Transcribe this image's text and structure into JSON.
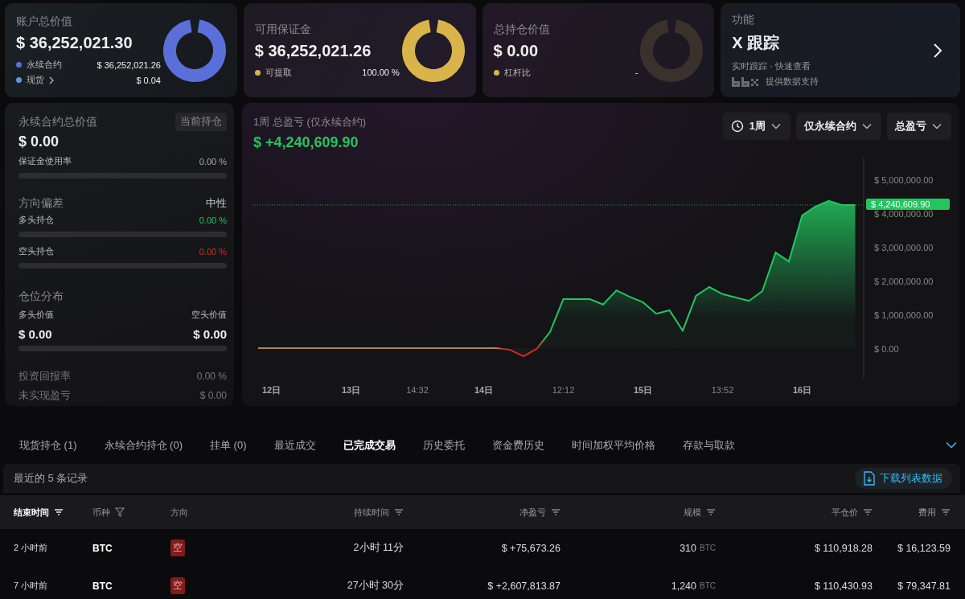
{
  "summary_cards": [
    {
      "title": "账户总价值",
      "value": "$ 36,252,021.30",
      "color": "#5b6fd8",
      "legend": [
        {
          "label": "永续合约",
          "value": "$ 36,252,021.26",
          "color": "#5b6fd8",
          "link": false
        },
        {
          "label": "现货",
          "value": "$ 0.04",
          "color": "#5b9bd8",
          "link": true
        }
      ]
    },
    {
      "title": "可用保证金",
      "value": "$ 36,252,021.26",
      "color": "#d9b44a",
      "legend": [
        {
          "label": "可提取",
          "value": "100.00 %",
          "color": "#d9b44a",
          "link": false
        }
      ]
    },
    {
      "title": "总持仓价值",
      "value": "$ 0.00",
      "color": "#3a302c",
      "legend": [
        {
          "label": "杠杆比",
          "value": "-",
          "color": "#d9b44a",
          "link": false
        }
      ]
    }
  ],
  "feature_card": {
    "title": "功能",
    "name": "X 跟踪",
    "subtitle": "实时跟踪 · 快速查看",
    "credit": "提供数据支持"
  },
  "perp_panel": {
    "title": "永续合约总价值",
    "badge": "当前持仓",
    "value": "$ 0.00",
    "margin": {
      "label": "保证金使用率",
      "reading": "0.00 %",
      "level": 0
    },
    "bias": {
      "title": "方向偏差",
      "value": "中性"
    },
    "long": {
      "label": "多头持仓",
      "reading": "0.00 %",
      "level": 0
    },
    "short": {
      "label": "空头持仓",
      "reading": "0.00 %",
      "level": 0
    },
    "distribution": {
      "title": "仓位分布",
      "long_label": "多头价值",
      "short_label": "空头价值",
      "long_value": "$ 0.00",
      "short_value": "$ 0.00",
      "level": 0
    },
    "roi": {
      "label": "投资回报率",
      "value": "0.00 %"
    },
    "unrealized": {
      "label": "未实现盈亏",
      "value": "$ 0.00"
    }
  },
  "pnl_panel": {
    "title": "1周 总盈亏 (仅永续合约)",
    "value": "$ +4,240,609.90",
    "filters": [
      "1周",
      "仅永续合约",
      "总盈亏"
    ],
    "chart_data": {
      "type": "area",
      "ylim": [
        -900000,
        5650000
      ],
      "categories": [
        null,
        "12日",
        null,
        null,
        null,
        null,
        null,
        "13日",
        null,
        null,
        null,
        null,
        "14:32",
        null,
        null,
        null,
        null,
        "14日",
        null,
        null,
        null,
        null,
        null,
        "12:12",
        null,
        null,
        null,
        null,
        null,
        "15日",
        null,
        null,
        null,
        null,
        null,
        "13:52",
        null,
        null,
        null,
        null,
        null,
        "16日",
        null,
        null,
        null,
        null
      ],
      "yticks": [
        {
          "value": 0,
          "label": "$ 0.00"
        },
        {
          "value": 1000000,
          "label": "$ 1,000,000.00"
        },
        {
          "value": 2000000,
          "label": "$ 2,000,000.00"
        },
        {
          "value": 3000000,
          "label": "$ 3,000,000.00"
        },
        {
          "value": 4000000,
          "label": "$ 4,000,000.00"
        },
        {
          "value": 5000000,
          "label": "$ 5,000,000.00"
        }
      ],
      "series": [
        {
          "color": "#22c55e",
          "values": [
            0,
            0,
            0,
            0,
            0,
            0,
            0,
            0,
            0,
            0,
            0,
            0,
            0,
            0,
            0,
            0,
            0,
            0,
            0,
            -50000,
            -240000,
            -20000,
            480000,
            1450000,
            1450000,
            1450000,
            1290000,
            1710000,
            1520000,
            1360000,
            1020000,
            1120000,
            520000,
            1550000,
            1810000,
            1600000,
            1500000,
            1400000,
            1690000,
            2830000,
            2570000,
            3930000,
            4190000,
            4360000,
            4240000,
            4240000
          ]
        }
      ],
      "ref_lines": [
        {
          "axis": "y",
          "value": 4240609.9,
          "label": "$ 4,240,609.90"
        }
      ]
    }
  },
  "tabs": [
    {
      "label": "现货持仓 (1)",
      "selected": false
    },
    {
      "label": "永续合约持仓 (0)",
      "selected": false
    },
    {
      "label": "挂单 (0)",
      "selected": false
    },
    {
      "label": "最近成交",
      "selected": false
    },
    {
      "label": "已完成交易",
      "selected": true
    },
    {
      "label": "历史委托",
      "selected": false
    },
    {
      "label": "资金费历史",
      "selected": false
    },
    {
      "label": "时间加权平均价格",
      "selected": false
    },
    {
      "label": "存款与取款",
      "selected": false
    }
  ],
  "table": {
    "caption": "最近的 5 条记录",
    "download": "下载列表数据",
    "columns": [
      {
        "label": "结束时间",
        "sorted": true
      },
      {
        "label": "币种",
        "sorted": false
      },
      {
        "label": "方向",
        "sorted": false
      },
      {
        "label": "持续时间",
        "sorted": false
      },
      {
        "label": "净盈亏",
        "sorted": false
      },
      {
        "label": "规模",
        "sorted": false
      },
      {
        "label": "平仓价",
        "sorted": false
      },
      {
        "label": "费用",
        "sorted": false
      }
    ],
    "rows": [
      {
        "time": "2 小时前",
        "coin": "BTC",
        "side": "空",
        "duration": "2小时 11分",
        "pnl": "$ +75,673.26",
        "size": "310",
        "unit": "BTC",
        "close_price": "$ 110,918.28",
        "fee": "$ 16,123.59"
      },
      {
        "time": "7 小时前",
        "coin": "BTC",
        "side": "空",
        "duration": "27小时 30分",
        "pnl": "$ +2,607,813.87",
        "size": "1,240",
        "unit": "BTC",
        "close_price": "$ 110,430.93",
        "fee": "$ 79,347.81"
      }
    ]
  }
}
